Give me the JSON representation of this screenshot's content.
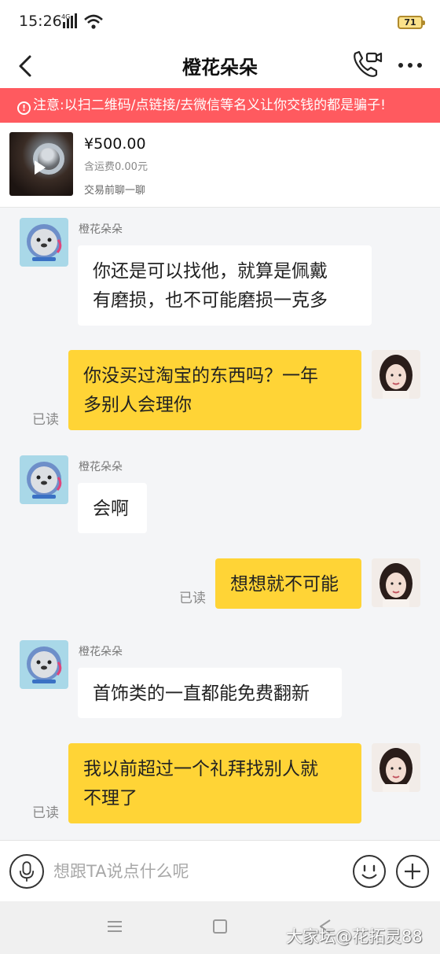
{
  "status_bar": {
    "time": "15:26",
    "network": "4G",
    "battery": "71"
  },
  "header": {
    "title": "橙花朵朵",
    "back_icon": "back-arrow-icon",
    "call_icon": "video-call-icon",
    "more_icon": "more-dots-icon"
  },
  "warning": {
    "text": "注意:以扫二维码/点链接/去微信等名义让你交钱的都是骗子!",
    "icon": "exclamation-circle-icon",
    "color": "#ff5a5f"
  },
  "product": {
    "price": "¥500.00",
    "shipping": "含运费0.00元",
    "chat_hint": "交易前聊一聊"
  },
  "messages": [
    {
      "side": "left",
      "sender": "橙花朵朵",
      "text_lines": [
        "你还是可以找他，就算是佩戴",
        "有磨损，也不可能磨损一克多"
      ]
    },
    {
      "side": "right",
      "status": "已读",
      "text_lines": [
        "你没买过淘宝的东西吗？一年",
        "多别人会理你"
      ]
    },
    {
      "side": "left",
      "sender": "橙花朵朵",
      "text_lines": [
        "会啊"
      ]
    },
    {
      "side": "right",
      "status": "已读",
      "text_lines": [
        "想想就不可能"
      ]
    },
    {
      "side": "left",
      "sender": "橙花朵朵",
      "text_lines": [
        "首饰类的一直都能免费翻新"
      ]
    },
    {
      "side": "right",
      "status": "已读",
      "text_lines": [
        "我以前超过一个礼拜找别人就",
        "不理了"
      ]
    }
  ],
  "input": {
    "placeholder": "想跟TA说点什么呢",
    "value": "",
    "mic_icon": "microphone-icon",
    "emoji_icon": "smiley-icon",
    "plus_icon": "plus-circle-icon"
  },
  "watermark": "大家坛@花拓灵88",
  "colors": {
    "accent_bubble": "#ffd436",
    "background": "#f4f5f7"
  }
}
